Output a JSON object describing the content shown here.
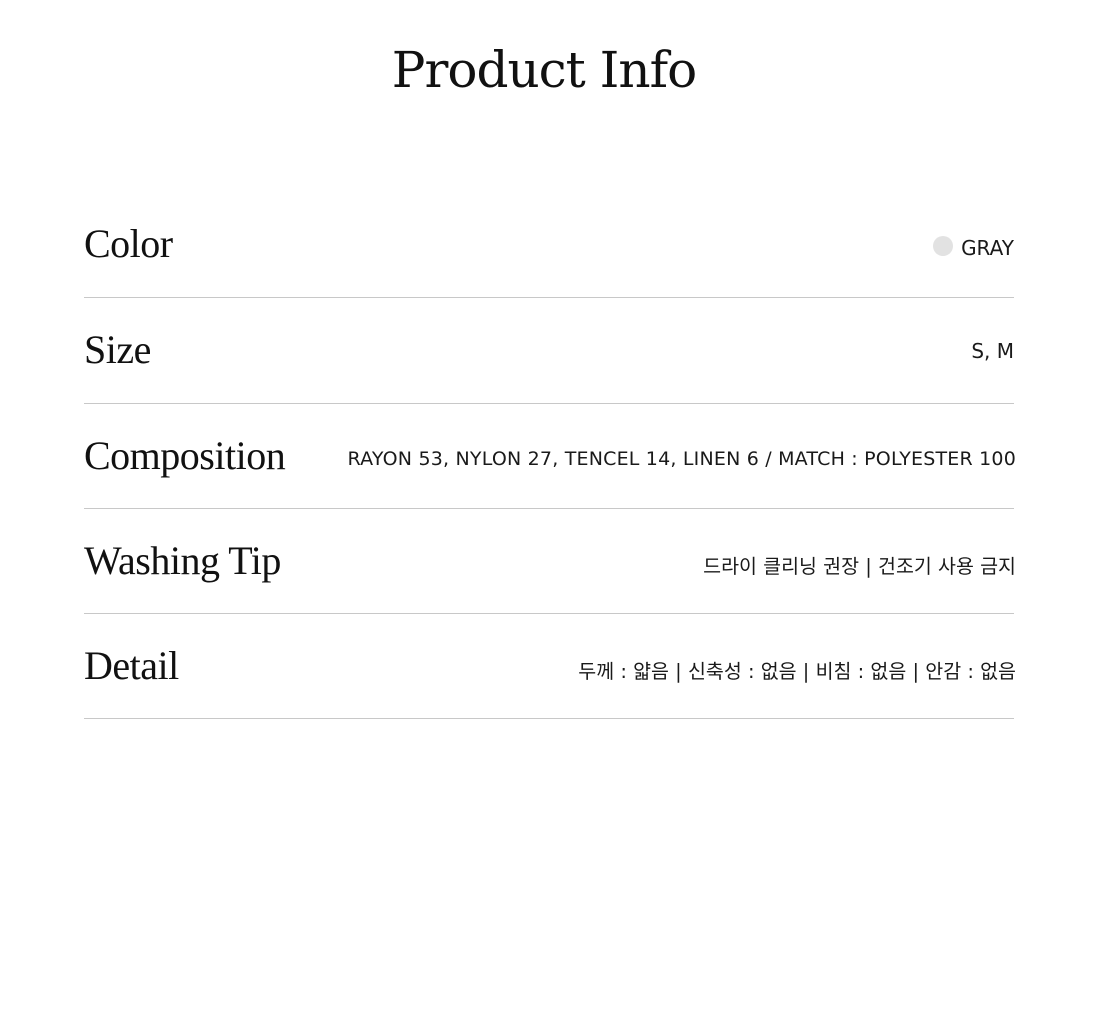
{
  "page": {
    "title": "Product Info"
  },
  "rows": [
    {
      "label": "Color",
      "value": "GRAY",
      "swatch_color": "#e2e2e2"
    },
    {
      "label": "Size",
      "value": "S, M"
    },
    {
      "label": "Composition",
      "value": "RAYON 53, NYLON 27, TENCEL 14, LINEN 6  /  MATCH : POLYESTER 100"
    },
    {
      "label": "Washing Tip",
      "value": "드라이 클리닝 권장  |  건조기 사용 금지"
    },
    {
      "label": "Detail",
      "value": "두께 : 얇음  |  신축성 : 없음  |  비침 : 없음  |  안감 : 없음"
    }
  ],
  "colors": {
    "text": "#111111",
    "divider": "#c8c8c8",
    "background": "#ffffff"
  }
}
